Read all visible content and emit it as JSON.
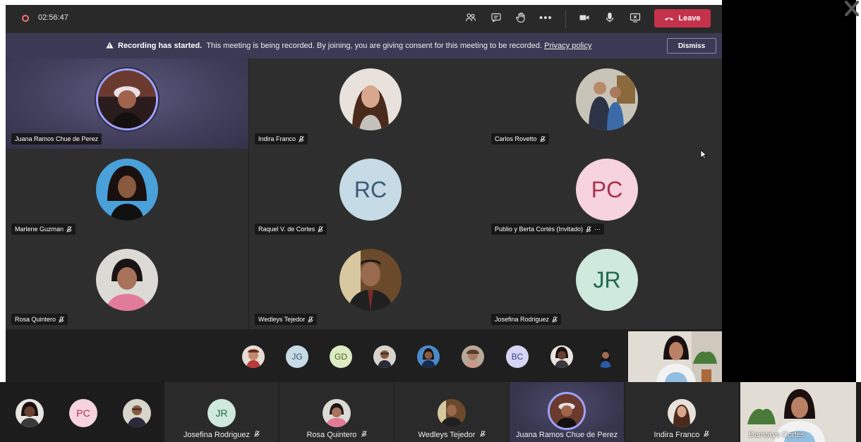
{
  "topbar": {
    "timer": "02:56:47",
    "icons": [
      "people-icon",
      "chat-icon",
      "raise-hand-icon",
      "more-icon",
      "camera-icon",
      "mic-icon",
      "share-icon"
    ],
    "leave_label": "Leave"
  },
  "banner": {
    "bold": "Recording has started.",
    "text": "This meeting is being recorded. By joining, you are giving consent for this meeting to be recorded.",
    "link": "Privacy policy",
    "dismiss_label": "Dismiss"
  },
  "grid": [
    {
      "name": "Juana Ramos Chue de Perez",
      "initials": "",
      "muted": false,
      "active": true
    },
    {
      "name": "Indira Franco",
      "initials": "",
      "muted": true,
      "active": false
    },
    {
      "name": "Carlos Rovetto",
      "initials": "",
      "muted": true,
      "active": false
    },
    {
      "name": "Marlene Guzman",
      "initials": "",
      "muted": true,
      "active": false
    },
    {
      "name": "Raquel V. de Cortes",
      "initials": "RC",
      "muted": true,
      "active": false
    },
    {
      "name": "Publio y Berta Cortés (Invitado)",
      "initials": "PC",
      "muted": true,
      "active": false,
      "more": "···"
    },
    {
      "name": "Rosa Quintero",
      "initials": "",
      "muted": true,
      "active": false
    },
    {
      "name": "Wedleys Tejedor",
      "initials": "",
      "muted": true,
      "active": false
    },
    {
      "name": "Josefina Rodriguez",
      "initials": "JR",
      "muted": true,
      "active": false
    }
  ],
  "strip": [
    {
      "initials": ""
    },
    {
      "initials": "JG"
    },
    {
      "initials": "GD"
    },
    {
      "initials": ""
    },
    {
      "initials": ""
    },
    {
      "initials": ""
    },
    {
      "initials": "BC"
    },
    {
      "initials": ""
    },
    {
      "initials": ""
    }
  ],
  "bottom": {
    "small": [
      {
        "initials": ""
      },
      {
        "initials": "PC"
      },
      {
        "initials": ""
      }
    ],
    "tiles": [
      {
        "name": "Josefina Rodriguez",
        "initials": "JR"
      },
      {
        "name": "Rosa Quintero",
        "initials": ""
      },
      {
        "name": "Wedleys Tejedor",
        "initials": ""
      },
      {
        "name": "Juana Ramos Chue de Perez",
        "initials": ""
      },
      {
        "name": "Indira Franco",
        "initials": ""
      }
    ],
    "self_name": "Damarys Cortes"
  },
  "colors": {
    "leave": "#c4314b",
    "banner": "#3b3a54",
    "rc_bg": "#c7dbe6",
    "pc_bg": "#f6d3de",
    "jr_bg": "#cfe9dc",
    "ring": "#9ea2ff"
  }
}
